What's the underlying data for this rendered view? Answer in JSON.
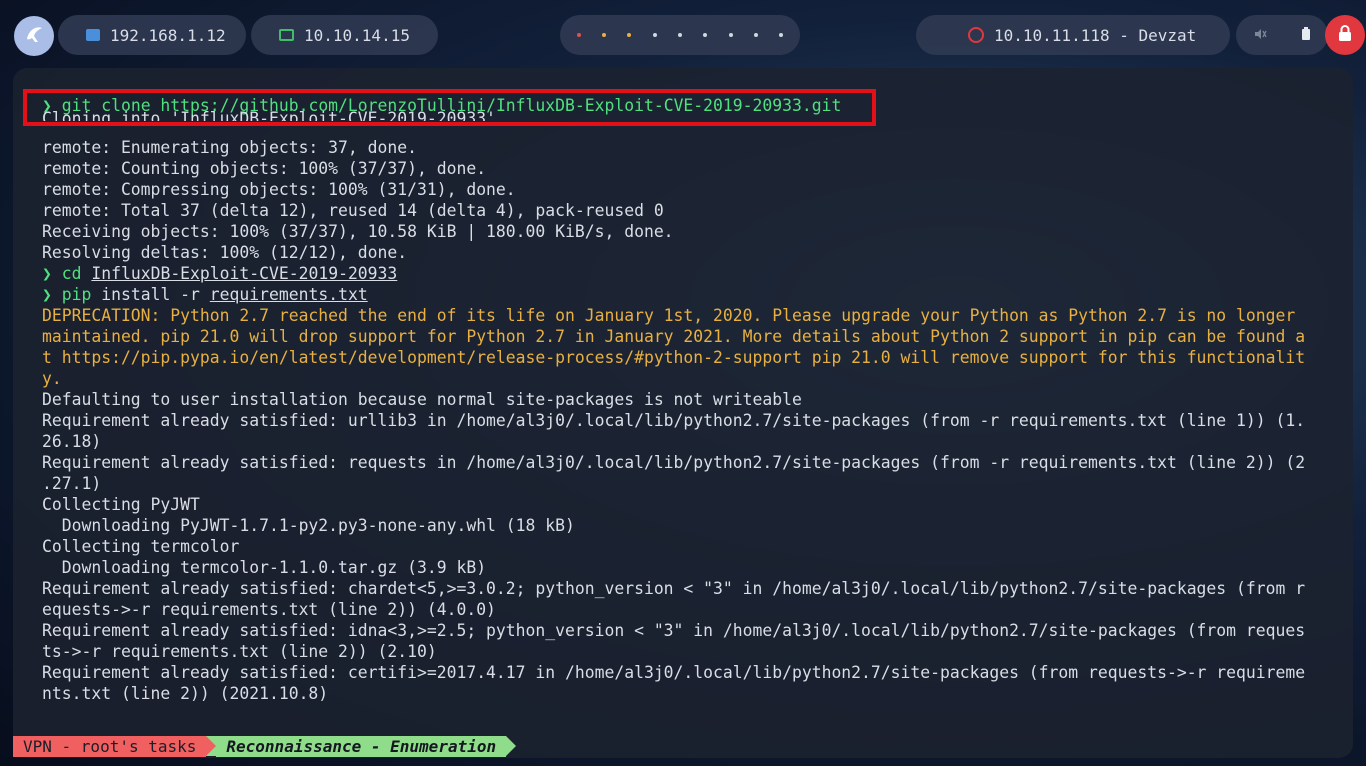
{
  "topbar": {
    "ip_local": "192.168.1.12",
    "ip_vpn": "10.10.14.15",
    "target": "10.10.11.118 - Devzat"
  },
  "terminal": {
    "prompt_symbol": "❯",
    "cmd1": "git clone https://github.com/LorenzoTullini/InfluxDB-Exploit-CVE-2019-20933.git",
    "cloning": "Cloning into 'InfluxDB-Exploit-CVE-2019-20933'...",
    "l_enum": "remote: Enumerating objects: 37, done.",
    "l_count": "remote: Counting objects: 100% (37/37), done.",
    "l_compress": "remote: Compressing objects: 100% (31/31), done.",
    "l_total": "remote: Total 37 (delta 12), reused 14 (delta 4), pack-reused 0",
    "l_receiving": "Receiving objects: 100% (37/37), 10.58 KiB | 180.00 KiB/s, done.",
    "l_resolving": "Resolving deltas: 100% (12/12), done.",
    "cd_cmd": "cd",
    "cd_arg": "InfluxDB-Exploit-CVE-2019-20933",
    "pip_cmd": "pip",
    "pip_args": "install -r",
    "pip_file": "requirements.txt",
    "dep1": "DEPRECATION: Python 2.7 reached the end of its life on January 1st, 2020. Please upgrade your Python as Python 2.7 is no longer",
    "dep2": "maintained. pip 21.0 will drop support for Python 2.7 in January 2021. More details about Python 2 support in pip can be found a",
    "dep3": "t https://pip.pypa.io/en/latest/development/release-process/#python-2-support pip 21.0 will remove support for this functionalit",
    "dep4": "y.",
    "o1": "Defaulting to user installation because normal site-packages is not writeable",
    "o2": "Requirement already satisfied: urllib3 in /home/al3j0/.local/lib/python2.7/site-packages (from -r requirements.txt (line 1)) (1.",
    "o3": "26.18)",
    "o4": "Requirement already satisfied: requests in /home/al3j0/.local/lib/python2.7/site-packages (from -r requirements.txt (line 2)) (2",
    "o5": ".27.1)",
    "o6": "Collecting PyJWT",
    "o7": "  Downloading PyJWT-1.7.1-py2.py3-none-any.whl (18 kB)",
    "o8": "Collecting termcolor",
    "o9": "  Downloading termcolor-1.1.0.tar.gz (3.9 kB)",
    "o10": "Requirement already satisfied: chardet<5,>=3.0.2; python_version < \"3\" in /home/al3j0/.local/lib/python2.7/site-packages (from r",
    "o11": "equests->-r requirements.txt (line 2)) (4.0.0)",
    "o12": "Requirement already satisfied: idna<3,>=2.5; python_version < \"3\" in /home/al3j0/.local/lib/python2.7/site-packages (from reques",
    "o13": "ts->-r requirements.txt (line 2)) (2.10)",
    "o14": "Requirement already satisfied: certifi>=2017.4.17 in /home/al3j0/.local/lib/python2.7/site-packages (from requests->-r requireme",
    "o15": "nts.txt (line 2)) (2021.10.8)"
  },
  "statusbar": {
    "left": "VPN - root's tasks",
    "right": "Reconnaissance - Enumeration"
  },
  "colors": {
    "prompt_green": "#4fe07f",
    "warning_yellow": "#e8b040",
    "highlight_red": "#e3101a"
  },
  "icons": [
    "app-logo-icon",
    "network-icon",
    "monitor-icon",
    "target-icon",
    "mute-icon",
    "battery-icon",
    "lock-icon"
  ]
}
